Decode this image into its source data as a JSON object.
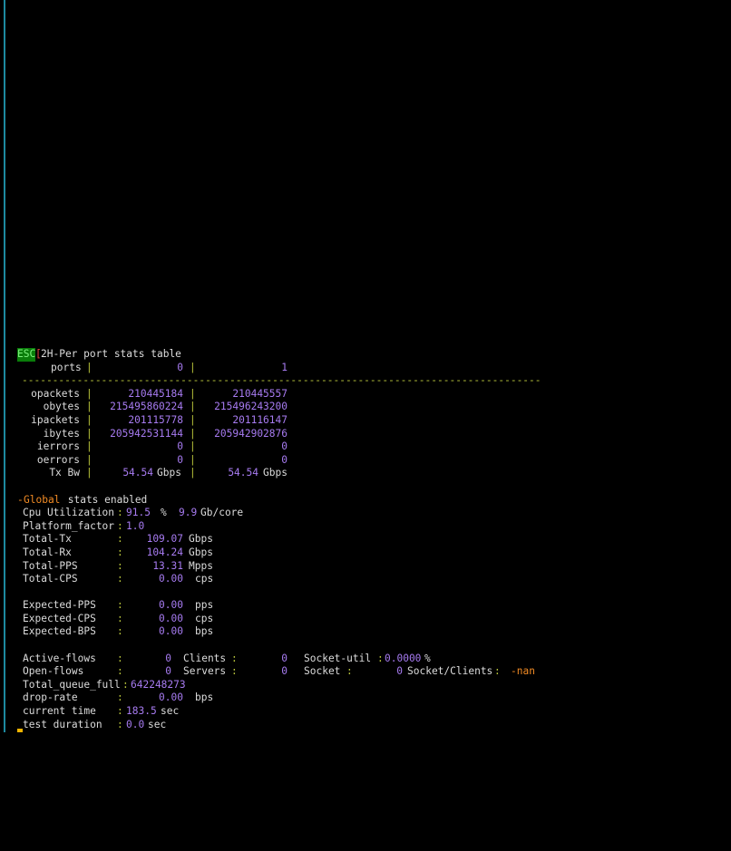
{
  "header": {
    "esc_tag": "ESC",
    "esc_bracket": "[",
    "title": "2H-Per port stats table"
  },
  "port_table": {
    "ports_label": "ports",
    "sep": "|",
    "ports": [
      "0",
      "1"
    ],
    "divider": "-------------------------------------------------------------------------------------",
    "rows": [
      {
        "label": "opackets",
        "values": [
          "210445184",
          "210445557"
        ],
        "unit": ""
      },
      {
        "label": "obytes",
        "values": [
          "215495860224",
          "215496243200"
        ],
        "unit": ""
      },
      {
        "label": "ipackets",
        "values": [
          "201115778",
          "201116147"
        ],
        "unit": ""
      },
      {
        "label": "ibytes",
        "values": [
          "205942531144",
          "205942902876"
        ],
        "unit": ""
      },
      {
        "label": "ierrors",
        "values": [
          "0",
          "0"
        ],
        "unit": ""
      },
      {
        "label": "oerrors",
        "values": [
          "0",
          "0"
        ],
        "unit": ""
      },
      {
        "label": "Tx Bw",
        "values": [
          "54.54",
          "54.54"
        ],
        "unit": "Gbps"
      }
    ]
  },
  "global": {
    "dash": "-",
    "word": "Global",
    "rest": " stats enabled",
    "cpu_label": "Cpu Utilization",
    "cpu_value": "91.5",
    "cpu_pct": "%",
    "cpu_per_core": "9.9",
    "cpu_per_core_unit": "Gb/core",
    "platform_label": "Platform_factor",
    "platform_value": "1.0",
    "totals": [
      {
        "label": "Total-Tx",
        "value": "109.07",
        "unit": "Gbps"
      },
      {
        "label": "Total-Rx",
        "value": "104.24",
        "unit": "Gbps"
      },
      {
        "label": "Total-PPS",
        "value": "13.31",
        "unit": "Mpps"
      },
      {
        "label": "Total-CPS",
        "value": "0.00",
        "unit": "cps"
      }
    ],
    "expected": [
      {
        "label": "Expected-PPS",
        "value": "0.00",
        "unit": "pps"
      },
      {
        "label": "Expected-CPS",
        "value": "0.00",
        "unit": "cps"
      },
      {
        "label": "Expected-BPS",
        "value": "0.00",
        "unit": "bps"
      }
    ],
    "active_flows_label": "Active-flows",
    "active_flows_value": "0",
    "clients_label": "Clients",
    "clients_value": "0",
    "socket_util_label": "Socket-util",
    "socket_util_value": "0.0000",
    "socket_util_unit": "%",
    "open_flows_label": "Open-flows",
    "open_flows_value": "0",
    "servers_label": "Servers",
    "servers_value": "0",
    "socket_label": "Socket",
    "socket_value": "0",
    "socket_clients_label": "Socket/Clients",
    "socket_clients_value": "-nan",
    "queue_full_label": "Total_queue_full",
    "queue_full_value": "642248273",
    "drop_rate_label": "drop-rate",
    "drop_rate_value": "0.00",
    "drop_rate_unit": "bps",
    "current_time_label": "current time",
    "current_time_value": "183.5",
    "current_time_unit": "sec",
    "test_duration_label": "test duration",
    "test_duration_value": "0.0",
    "test_duration_unit": "sec",
    "colon": ":"
  },
  "colors": {
    "background": "#000000",
    "text": "#dcdcdc",
    "separator": "#b9c53b",
    "value": "#a77bf1",
    "accent_orange": "#f08a24",
    "esc_bg": "#0a7d0a",
    "border": "#1d8aa0"
  }
}
